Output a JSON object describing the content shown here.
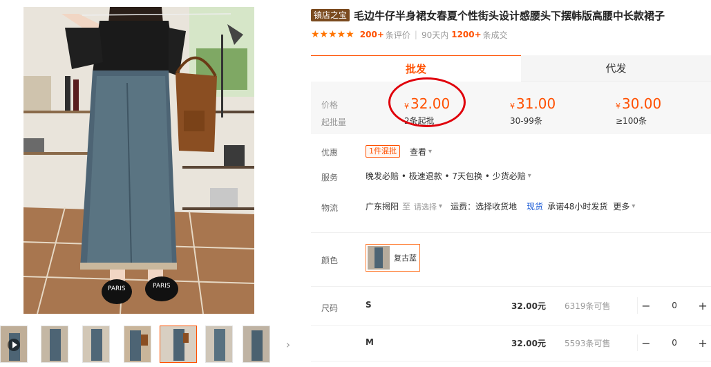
{
  "product": {
    "badge": "镇店之宝",
    "title": "毛边牛仔半身裙女春夏个性街头设计感腰头下摆韩版高腰中长款裙子"
  },
  "rating": {
    "stars": "★★★★★",
    "review_count": "200+",
    "review_label": "条评价",
    "period": "90天内",
    "deal_count": "1200+",
    "deal_label": "条成交"
  },
  "tabs": {
    "wholesale": "批发",
    "dropship": "代发"
  },
  "price_box": {
    "price_label": "价格",
    "moq_label": "起批量",
    "currency": "¥",
    "tiers": [
      {
        "price": "32.00",
        "qty": "2条起批"
      },
      {
        "price": "31.00",
        "qty": "30-99条"
      },
      {
        "price": "30.00",
        "qty": "≥100条"
      }
    ]
  },
  "promo": {
    "label": "优惠",
    "tag": "1件混批",
    "view": "查看"
  },
  "service": {
    "label": "服务",
    "text": "晚发必赔 • 极速退款 • 7天包换 • 少货必赔"
  },
  "logistics": {
    "label": "物流",
    "origin": "广东揭阳",
    "to": "至",
    "select_placeholder": "请选择",
    "freight": "运费：选择收货地",
    "stock_type": "现货",
    "promise": "承诺48小时发货",
    "more": "更多"
  },
  "color": {
    "label": "颜色",
    "option": "复古蓝"
  },
  "size": {
    "label": "尺码",
    "rows": [
      {
        "name": "S",
        "price": "32.00元",
        "stock": "6319条可售",
        "qty": "0"
      },
      {
        "name": "M",
        "price": "32.00元",
        "stock": "5593条可售",
        "qty": "0"
      }
    ]
  },
  "icons": {
    "play": "play-icon",
    "next": "chevron-right-icon",
    "dropdown": "chevron-down-icon"
  },
  "colors": {
    "accent": "#ff5000",
    "annotation_circle": "#e0000b",
    "badge": "#7a4a1e"
  }
}
